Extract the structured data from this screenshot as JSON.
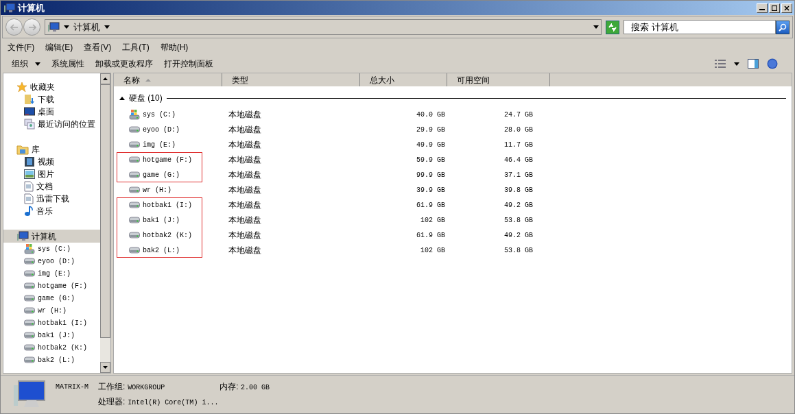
{
  "window": {
    "title": "计算机"
  },
  "address": {
    "path": "计算机",
    "search_placeholder": "搜索 计算机"
  },
  "menu": [
    "文件(F)",
    "编辑(E)",
    "查看(V)",
    "工具(T)",
    "帮助(H)"
  ],
  "toolbar": [
    {
      "label": "组织",
      "dropdown": true
    },
    {
      "label": "系统属性",
      "dropdown": false
    },
    {
      "label": "卸载或更改程序",
      "dropdown": false
    },
    {
      "label": "打开控制面板",
      "dropdown": false
    }
  ],
  "sidebar": {
    "sections": [
      {
        "label": "收藏夹",
        "kind": "favorites",
        "selected": false,
        "children": [
          {
            "label": "下载",
            "kind": "download"
          },
          {
            "label": "桌面",
            "kind": "desktop"
          },
          {
            "label": "最近访问的位置",
            "kind": "recent"
          }
        ]
      },
      {
        "label": "库",
        "kind": "library",
        "selected": false,
        "children": [
          {
            "label": "视频",
            "kind": "video"
          },
          {
            "label": "图片",
            "kind": "picture"
          },
          {
            "label": "文档",
            "kind": "document"
          },
          {
            "label": "迅雷下载",
            "kind": "document"
          },
          {
            "label": "音乐",
            "kind": "music"
          }
        ]
      },
      {
        "label": "计算机",
        "kind": "computer",
        "selected": true,
        "children": [
          {
            "label": "sys (C:)",
            "kind": "system"
          },
          {
            "label": "eyoo (D:)",
            "kind": "drive"
          },
          {
            "label": "img (E:)",
            "kind": "drive"
          },
          {
            "label": "hotgame (F:)",
            "kind": "drive"
          },
          {
            "label": "game (G:)",
            "kind": "drive"
          },
          {
            "label": "wr (H:)",
            "kind": "drive"
          },
          {
            "label": "hotbak1 (I:)",
            "kind": "drive"
          },
          {
            "label": "bak1 (J:)",
            "kind": "drive"
          },
          {
            "label": "hotbak2 (K:)",
            "kind": "drive"
          },
          {
            "label": "bak2 (L:)",
            "kind": "drive"
          }
        ]
      }
    ]
  },
  "table": {
    "columns": [
      "名称",
      "类型",
      "总大小",
      "可用空间"
    ],
    "group": {
      "label": "硬盘 (10)",
      "expanded": true
    },
    "rows": [
      {
        "name": "sys (C:)",
        "kind": "system",
        "type": "本地磁盘",
        "total": "40.0 GB",
        "free": "24.7 GB",
        "highlighted": false
      },
      {
        "name": "eyoo (D:)",
        "kind": "drive",
        "type": "本地磁盘",
        "total": "29.9 GB",
        "free": "28.0 GB",
        "highlighted": false
      },
      {
        "name": "img (E:)",
        "kind": "drive",
        "type": "本地磁盘",
        "total": "49.9 GB",
        "free": "11.7 GB",
        "highlighted": false
      },
      {
        "name": "hotgame (F:)",
        "kind": "drive",
        "type": "本地磁盘",
        "total": "59.9 GB",
        "free": "46.4 GB",
        "highlighted": true
      },
      {
        "name": "game (G:)",
        "kind": "drive",
        "type": "本地磁盘",
        "total": "99.9 GB",
        "free": "37.1 GB",
        "highlighted": true
      },
      {
        "name": "wr (H:)",
        "kind": "drive",
        "type": "本地磁盘",
        "total": "39.9 GB",
        "free": "39.8 GB",
        "highlighted": false
      },
      {
        "name": "hotbak1 (I:)",
        "kind": "drive",
        "type": "本地磁盘",
        "total": "61.9 GB",
        "free": "49.2 GB",
        "highlighted": true
      },
      {
        "name": "bak1 (J:)",
        "kind": "drive",
        "type": "本地磁盘",
        "total": "102 GB",
        "free": "53.8 GB",
        "highlighted": true
      },
      {
        "name": "hotbak2 (K:)",
        "kind": "drive",
        "type": "本地磁盘",
        "total": "61.9 GB",
        "free": "49.2 GB",
        "highlighted": true
      },
      {
        "name": "bak2 (L:)",
        "kind": "drive",
        "type": "本地磁盘",
        "total": "102 GB",
        "free": "53.8 GB",
        "highlighted": true
      }
    ]
  },
  "details": {
    "computer_name": "MATRIX-M",
    "workgroup_label": "工作组:",
    "workgroup": "WORKGROUP",
    "memory_label": "内存:",
    "memory": "2.00 GB",
    "cpu_label": "处理器:",
    "cpu": "Intel(R) Core(TM) i..."
  }
}
